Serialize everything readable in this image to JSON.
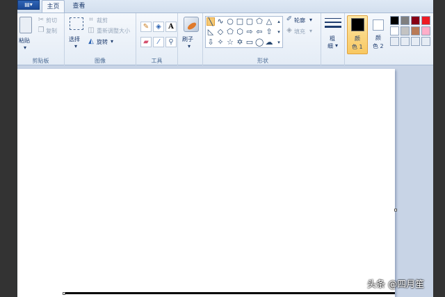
{
  "tabs": {
    "home": "主页",
    "view": "查看"
  },
  "clipboard": {
    "paste": "粘贴",
    "cut": "剪切",
    "copy": "复制",
    "group": "剪贴板"
  },
  "image": {
    "select": "选择",
    "crop": "裁剪",
    "resize": "重新调整大小",
    "rotate": "旋转",
    "group": "图像"
  },
  "tools": {
    "group": "工具",
    "text_glyph": "A"
  },
  "brush": {
    "label": "刷子"
  },
  "shapes": {
    "outline": "轮廓",
    "fill": "填充",
    "group": "形状"
  },
  "size": {
    "label_1": "粗",
    "label_2": "细"
  },
  "color1": {
    "label_1": "颜",
    "label_2": "色 1"
  },
  "color2": {
    "label_1": "颜",
    "label_2": "色 2"
  },
  "palette": {
    "row1": [
      "#000000",
      "#7f7f7f",
      "#880015",
      "#ed1c24"
    ],
    "row2": [
      "#ffffff",
      "#c3c3c3",
      "#b97a57",
      "#ffaec9"
    ],
    "row3": [
      "#e6ecf4",
      "#e6ecf4",
      "#e6ecf4",
      "#e6ecf4"
    ]
  },
  "watermark": "头条 @四月笙"
}
